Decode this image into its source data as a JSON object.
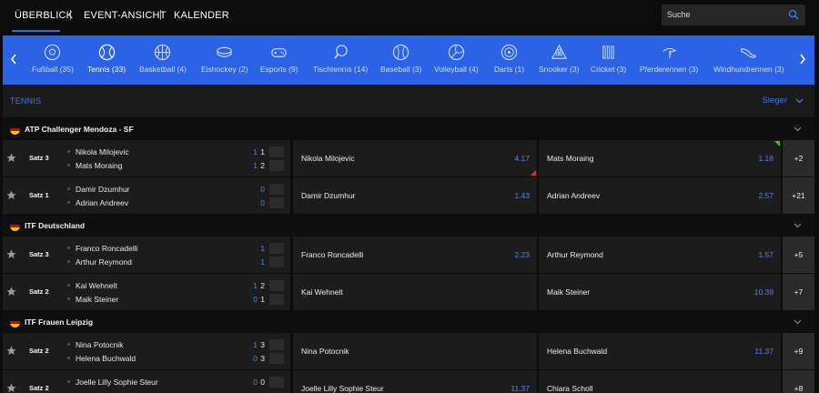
{
  "topnav": {
    "overview": "ÜBERBLICK",
    "event_view": "EVENT-ANSICHT",
    "calendar": "KALENDER",
    "separator": "|",
    "search_placeholder": "Suche"
  },
  "sports": [
    {
      "label": "Fußball (35)",
      "icon": "soccer-ball-icon"
    },
    {
      "label": "Tennis (33)",
      "icon": "tennis-ball-icon",
      "active": true
    },
    {
      "label": "Basketball (4)",
      "icon": "basketball-icon"
    },
    {
      "label": "Eishockey (2)",
      "icon": "hockey-puck-icon"
    },
    {
      "label": "Esports (9)",
      "icon": "gamepad-icon"
    },
    {
      "label": "Tischtennis (14)",
      "icon": "table-tennis-icon"
    },
    {
      "label": "Baseball (3)",
      "icon": "baseball-icon"
    },
    {
      "label": "Volleyball (4)",
      "icon": "volleyball-icon"
    },
    {
      "label": "Darts (1)",
      "icon": "dartboard-icon"
    },
    {
      "label": "Snooker (3)",
      "icon": "snooker-balls-icon"
    },
    {
      "label": "Cricket (3)",
      "icon": "cricket-wicket-icon"
    },
    {
      "label": "Pferderennen (3)",
      "icon": "horse-racing-icon"
    },
    {
      "label": "Windhundrennen (3)",
      "icon": "greyhound-icon"
    }
  ],
  "section": {
    "title": "TENNIS",
    "market": "Sieger"
  },
  "leagues": [
    {
      "name": "ATP Challenger Mendoza - SF",
      "matches": [
        {
          "set": "Satz 3",
          "p1": "Nikola Milojevic",
          "p2": "Mats Moraing",
          "s1a": "1",
          "s1b": "1",
          "s2a": "1",
          "s2b": "2",
          "odd1_name": "Nikola Milojevic",
          "odd1": "4.17",
          "odd2_name": "Mats Moraing",
          "odd2": "1.18",
          "more": "+2",
          "odd1_trend": "down",
          "odd2_trend": "up"
        },
        {
          "set": "Satz 1",
          "p1": "Damir Dzumhur",
          "p2": "Adrian Andreev",
          "s1a": "0",
          "s1b": "",
          "s2a": "0",
          "s2b": "",
          "odd1_name": "Damir Dzumhur",
          "odd1": "1.43",
          "odd2_name": "Adrian Andreev",
          "odd2": "2.57",
          "more": "+21"
        }
      ]
    },
    {
      "name": "ITF Deutschland",
      "matches": [
        {
          "set": "Satz 3",
          "p1": "Franco Roncadelli",
          "p2": "Arthur Reymond",
          "s1a": "1",
          "s1b": "",
          "s2a": "1",
          "s2b": "",
          "odd1_name": "Franco Roncadelli",
          "odd1": "2.23",
          "odd2_name": "Arthur Reymond",
          "odd2": "1.57",
          "more": "+5"
        },
        {
          "set": "Satz 2",
          "p1": "Kai Wehnelt",
          "p2": "Maik Steiner",
          "s1a": "1",
          "s1b": "2",
          "s2a": "0",
          "s2b": "1",
          "odd1_name": "Kai Wehnelt",
          "odd1": "",
          "odd2_name": "Maik Steiner",
          "odd2": "10.39",
          "more": "+7"
        }
      ]
    },
    {
      "name": "ITF Frauen Leipzig",
      "matches": [
        {
          "set": "Satz 2",
          "p1": "Nina Potocnik",
          "p2": "Helena Buchwald",
          "s1a": "1",
          "s1b": "3",
          "s2a": "0",
          "s2b": "3",
          "odd1_name": "Nina Potocnik",
          "odd1": "",
          "odd2_name": "Helena Buchwald",
          "odd2": "11.37",
          "more": "+9"
        },
        {
          "set": "Satz 2",
          "p1": "Joelle Lilly Sophie Steur",
          "p2": "",
          "s1a": "0",
          "s1b": "0",
          "s2a": "",
          "s2b": "",
          "odd1_name": "Joelle Lilly Sophie Steur",
          "odd1": "11.37",
          "odd2_name": "Chiara Scholl",
          "odd2": "",
          "more": "+8"
        }
      ]
    }
  ],
  "colors": {
    "accent": "#2c62e6",
    "odds": "#4d86f5",
    "trend_up": "#3cc23c",
    "trend_down": "#e03030"
  }
}
